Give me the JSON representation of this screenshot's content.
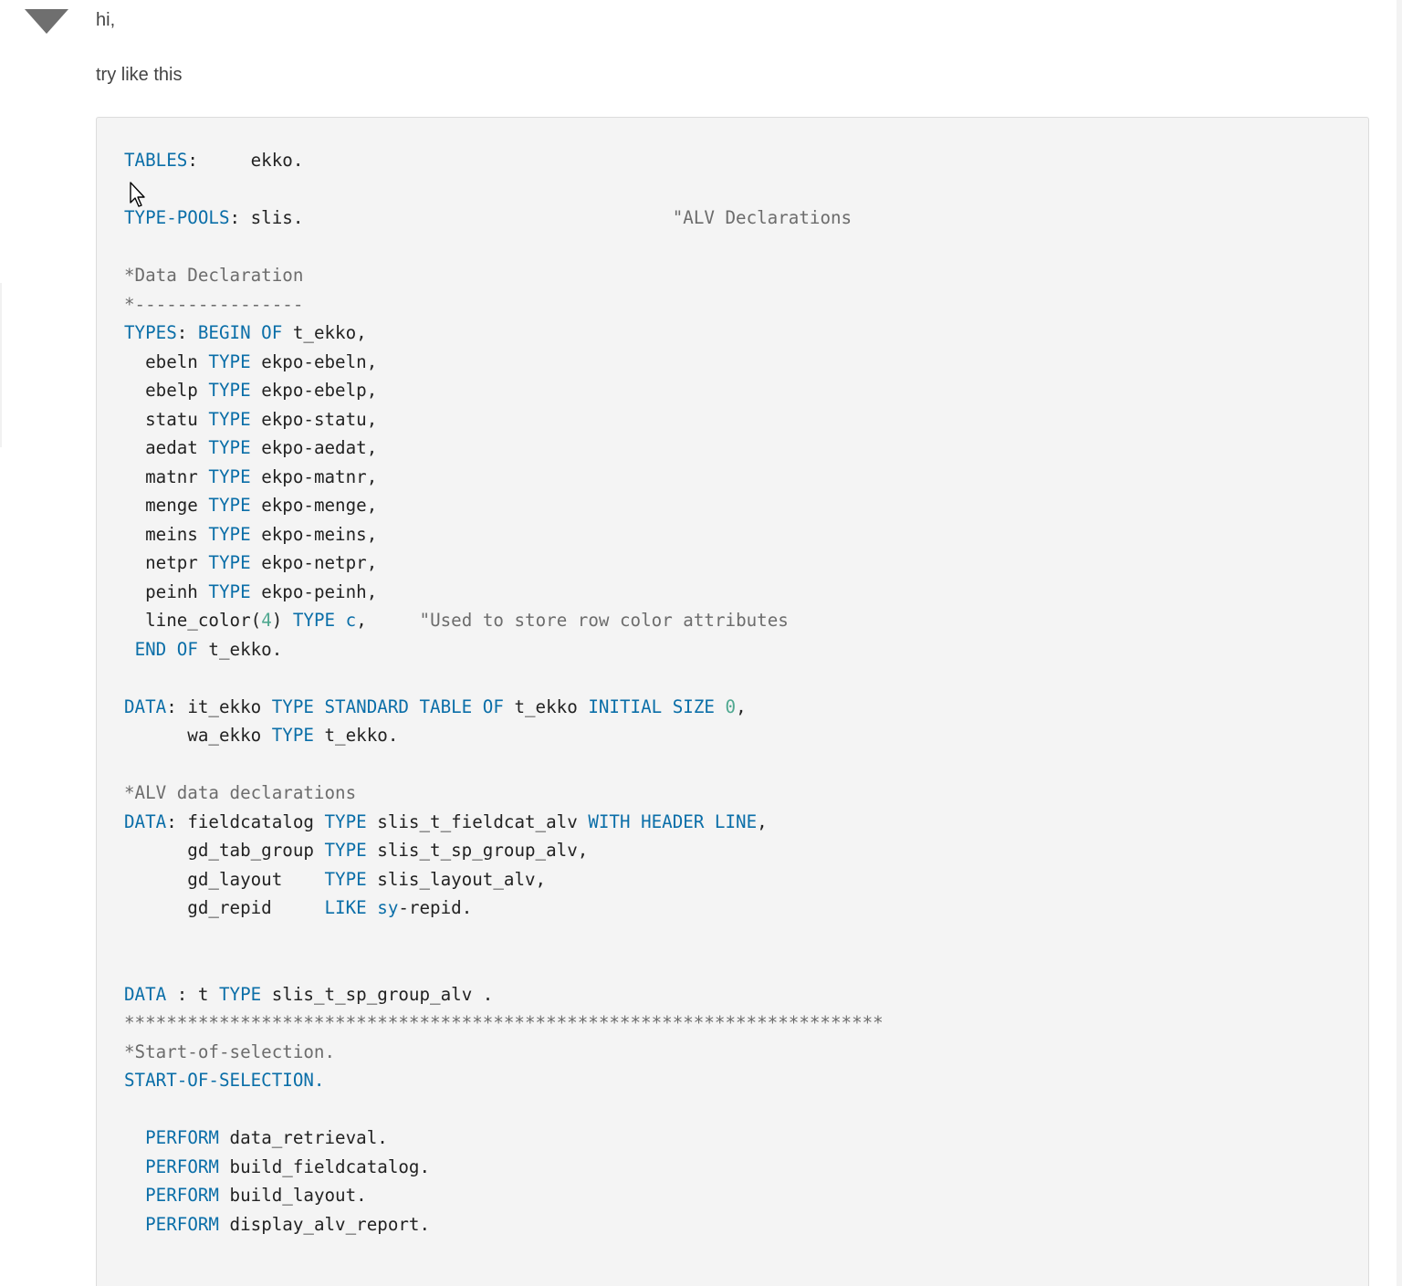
{
  "answer": {
    "greeting": "hi,",
    "intro": "try like this"
  },
  "code": {
    "language": "ABAP",
    "lines": [
      [
        [
          "kw",
          "TABLES"
        ],
        [
          "t",
          ":     ekko."
        ]
      ],
      [],
      [
        [
          "kw",
          "TYPE-POOLS"
        ],
        [
          "t",
          ": slis.                                   "
        ],
        [
          "cm",
          "\"ALV Declarations"
        ]
      ],
      [],
      [
        [
          "cm",
          "*Data Declaration"
        ]
      ],
      [
        [
          "cm",
          "*----------------"
        ]
      ],
      [
        [
          "kw",
          "TYPES"
        ],
        [
          "t",
          ": "
        ],
        [
          "kw",
          "BEGIN OF"
        ],
        [
          "t",
          " t_ekko,"
        ]
      ],
      [
        [
          "t",
          "  ebeln "
        ],
        [
          "kw",
          "TYPE"
        ],
        [
          "t",
          " ekpo-ebeln,"
        ]
      ],
      [
        [
          "t",
          "  ebelp "
        ],
        [
          "kw",
          "TYPE"
        ],
        [
          "t",
          " ekpo-ebelp,"
        ]
      ],
      [
        [
          "t",
          "  statu "
        ],
        [
          "kw",
          "TYPE"
        ],
        [
          "t",
          " ekpo-statu,"
        ]
      ],
      [
        [
          "t",
          "  aedat "
        ],
        [
          "kw",
          "TYPE"
        ],
        [
          "t",
          " ekpo-aedat,"
        ]
      ],
      [
        [
          "t",
          "  matnr "
        ],
        [
          "kw",
          "TYPE"
        ],
        [
          "t",
          " ekpo-matnr,"
        ]
      ],
      [
        [
          "t",
          "  menge "
        ],
        [
          "kw",
          "TYPE"
        ],
        [
          "t",
          " ekpo-menge,"
        ]
      ],
      [
        [
          "t",
          "  meins "
        ],
        [
          "kw",
          "TYPE"
        ],
        [
          "t",
          " ekpo-meins,"
        ]
      ],
      [
        [
          "t",
          "  netpr "
        ],
        [
          "kw",
          "TYPE"
        ],
        [
          "t",
          " ekpo-netpr,"
        ]
      ],
      [
        [
          "t",
          "  peinh "
        ],
        [
          "kw",
          "TYPE"
        ],
        [
          "t",
          " ekpo-peinh,"
        ]
      ],
      [
        [
          "t",
          "  line_color("
        ],
        [
          "num",
          "4"
        ],
        [
          "t",
          ") "
        ],
        [
          "kw",
          "TYPE"
        ],
        [
          "t",
          " "
        ],
        [
          "kw",
          "c"
        ],
        [
          "t",
          ",     "
        ],
        [
          "cm",
          "\"Used to store row color attributes"
        ]
      ],
      [
        [
          "t",
          " "
        ],
        [
          "kw",
          "END OF"
        ],
        [
          "t",
          " t_ekko."
        ]
      ],
      [],
      [
        [
          "kw",
          "DATA"
        ],
        [
          "t",
          ": it_ekko "
        ],
        [
          "kw",
          "TYPE STANDARD TABLE OF"
        ],
        [
          "t",
          " t_ekko "
        ],
        [
          "kw",
          "INITIAL SIZE"
        ],
        [
          "t",
          " "
        ],
        [
          "num",
          "0"
        ],
        [
          "t",
          ","
        ]
      ],
      [
        [
          "t",
          "      wa_ekko "
        ],
        [
          "kw",
          "TYPE"
        ],
        [
          "t",
          " t_ekko."
        ]
      ],
      [],
      [
        [
          "cm",
          "*ALV data declarations"
        ]
      ],
      [
        [
          "kw",
          "DATA"
        ],
        [
          "t",
          ": fieldcatalog "
        ],
        [
          "kw",
          "TYPE"
        ],
        [
          "t",
          " slis_t_fieldcat_alv "
        ],
        [
          "kw",
          "WITH HEADER LINE"
        ],
        [
          "t",
          ","
        ]
      ],
      [
        [
          "t",
          "      gd_tab_group "
        ],
        [
          "kw",
          "TYPE"
        ],
        [
          "t",
          " slis_t_sp_group_alv,"
        ]
      ],
      [
        [
          "t",
          "      gd_layout    "
        ],
        [
          "kw",
          "TYPE"
        ],
        [
          "t",
          " slis_layout_alv,"
        ]
      ],
      [
        [
          "t",
          "      gd_repid     "
        ],
        [
          "kw",
          "LIKE"
        ],
        [
          "t",
          " "
        ],
        [
          "kw",
          "sy"
        ],
        [
          "t",
          "-repid."
        ]
      ],
      [],
      [],
      [
        [
          "kw",
          "DATA"
        ],
        [
          "t",
          " : t "
        ],
        [
          "kw",
          "TYPE"
        ],
        [
          "t",
          " slis_t_sp_group_alv ."
        ]
      ],
      [
        [
          "cm",
          "************************************************************************"
        ]
      ],
      [
        [
          "cm",
          "*Start-of-selection."
        ]
      ],
      [
        [
          "kw",
          "START-OF-SELECTION."
        ]
      ],
      [],
      [
        [
          "t",
          "  "
        ],
        [
          "kw",
          "PERFORM"
        ],
        [
          "t",
          " data_retrieval."
        ]
      ],
      [
        [
          "t",
          "  "
        ],
        [
          "kw",
          "PERFORM"
        ],
        [
          "t",
          " build_fieldcatalog."
        ]
      ],
      [
        [
          "t",
          "  "
        ],
        [
          "kw",
          "PERFORM"
        ],
        [
          "t",
          " build_layout."
        ]
      ],
      [
        [
          "t",
          "  "
        ],
        [
          "kw",
          "PERFORM"
        ],
        [
          "t",
          " display_alv_report."
        ]
      ]
    ]
  },
  "colors": {
    "keyword": "#0a6ea8",
    "comment": "#6c6c6c",
    "number": "#4fa890",
    "text": "#222222",
    "code_background": "#f4f4f4"
  },
  "icons": {
    "vote": "collapse-triangle-icon",
    "pointer": "mouse-cursor-icon"
  }
}
